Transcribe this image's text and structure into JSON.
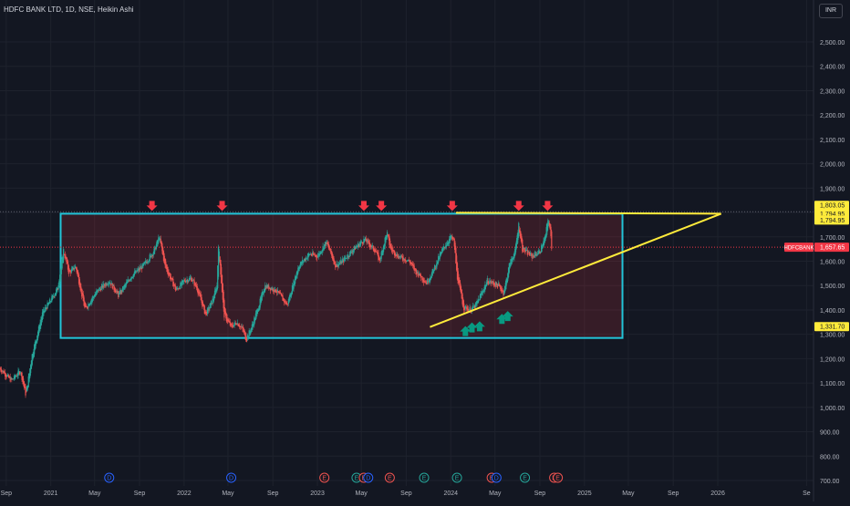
{
  "header": {
    "title": "HDFC BANK LTD, 1D, NSE, Heikin Ashi",
    "currency": "INR"
  },
  "chart_data": {
    "type": "candlestick",
    "symbol": "HDFCBANK",
    "ylim": [
      700,
      2600
    ],
    "y_ticks": [
      700,
      800,
      900,
      1000,
      1100,
      1200,
      1300,
      1400,
      1500,
      1600,
      1700,
      1800,
      1900,
      2000,
      2100,
      2200,
      2300,
      2400,
      2500
    ],
    "y_tick_labels": [
      "700.00",
      "800.00",
      "900.00",
      "1,000.00",
      "1,100.00",
      "1,200.00",
      "1,300.00",
      "1,400.00",
      "1,500.00",
      "1,600.00",
      "1,700.00",
      "1,800.00",
      "1,900.00",
      "2,000.00",
      "2,100.00",
      "2,200.00",
      "2,300.00",
      "2,400.00",
      "2,500.00"
    ],
    "x_labels": [
      "Sep",
      "2021",
      "May",
      "Sep",
      "2022",
      "May",
      "Sep",
      "2023",
      "May",
      "Sep",
      "2024",
      "May",
      "Sep",
      "2025",
      "May",
      "Sep",
      "2026",
      "Se"
    ],
    "x_label_dates": [
      "2020-09-01",
      "2021-01-01",
      "2021-05-01",
      "2021-09-01",
      "2022-01-01",
      "2022-05-01",
      "2022-09-01",
      "2023-01-01",
      "2023-05-01",
      "2023-09-01",
      "2024-01-01",
      "2024-05-01",
      "2024-09-01",
      "2025-01-01",
      "2025-05-01",
      "2025-09-01",
      "2026-01-01",
      "2026-09-01"
    ],
    "x_range": [
      "2020-08-15",
      "2026-09-20"
    ],
    "price_path": [
      [
        "2020-08-15",
        1160
      ],
      [
        "2020-09-15",
        1110
      ],
      [
        "2020-10-10",
        1150
      ],
      [
        "2020-10-25",
        1050
      ],
      [
        "2020-11-10",
        1210
      ],
      [
        "2020-12-10",
        1390
      ],
      [
        "2021-01-01",
        1440
      ],
      [
        "2021-01-20",
        1490
      ],
      [
        "2021-02-05",
        1645
      ],
      [
        "2021-02-20",
        1550
      ],
      [
        "2021-03-10",
        1580
      ],
      [
        "2021-04-05",
        1400
      ],
      [
        "2021-04-20",
        1440
      ],
      [
        "2021-05-10",
        1480
      ],
      [
        "2021-06-10",
        1520
      ],
      [
        "2021-07-05",
        1460
      ],
      [
        "2021-08-10",
        1540
      ],
      [
        "2021-09-10",
        1580
      ],
      [
        "2021-10-10",
        1640
      ],
      [
        "2021-10-25",
        1700
      ],
      [
        "2021-11-10",
        1580
      ],
      [
        "2021-12-10",
        1480
      ],
      [
        "2022-01-01",
        1520
      ],
      [
        "2022-01-20",
        1530
      ],
      [
        "2022-02-05",
        1490
      ],
      [
        "2022-03-01",
        1380
      ],
      [
        "2022-03-20",
        1440
      ],
      [
        "2022-04-01",
        1500
      ],
      [
        "2022-04-05",
        1670
      ],
      [
        "2022-04-20",
        1380
      ],
      [
        "2022-05-10",
        1330
      ],
      [
        "2022-05-25",
        1350
      ],
      [
        "2022-06-10",
        1320
      ],
      [
        "2022-06-20",
        1280
      ],
      [
        "2022-07-05",
        1330
      ],
      [
        "2022-07-25",
        1420
      ],
      [
        "2022-08-10",
        1500
      ],
      [
        "2022-09-10",
        1480
      ],
      [
        "2022-10-10",
        1420
      ],
      [
        "2022-11-10",
        1580
      ],
      [
        "2022-12-10",
        1630
      ],
      [
        "2023-01-01",
        1620
      ],
      [
        "2023-01-25",
        1680
      ],
      [
        "2023-02-20",
        1580
      ],
      [
        "2023-03-10",
        1600
      ],
      [
        "2023-04-10",
        1650
      ],
      [
        "2023-05-10",
        1690
      ],
      [
        "2023-06-10",
        1640
      ],
      [
        "2023-06-20",
        1600
      ],
      [
        "2023-07-10",
        1720
      ],
      [
        "2023-07-20",
        1650
      ],
      [
        "2023-08-10",
        1620
      ],
      [
        "2023-09-10",
        1600
      ],
      [
        "2023-09-25",
        1560
      ],
      [
        "2023-10-10",
        1540
      ],
      [
        "2023-10-26",
        1510
      ],
      [
        "2023-11-10",
        1550
      ],
      [
        "2023-12-10",
        1650
      ],
      [
        "2024-01-01",
        1700
      ],
      [
        "2024-01-10",
        1680
      ],
      [
        "2024-01-18",
        1540
      ],
      [
        "2024-02-05",
        1410
      ],
      [
        "2024-02-25",
        1400
      ],
      [
        "2024-03-10",
        1420
      ],
      [
        "2024-04-10",
        1520
      ],
      [
        "2024-05-10",
        1500
      ],
      [
        "2024-05-25",
        1470
      ],
      [
        "2024-06-10",
        1590
      ],
      [
        "2024-06-25",
        1640
      ],
      [
        "2024-07-05",
        1750
      ],
      [
        "2024-07-15",
        1650
      ],
      [
        "2024-08-10",
        1620
      ],
      [
        "2024-09-01",
        1640
      ],
      [
        "2024-09-16",
        1700
      ],
      [
        "2024-09-24",
        1780
      ],
      [
        "2024-10-01",
        1700
      ],
      [
        "2024-10-03",
        1657.65
      ]
    ],
    "last_price": 1657.65,
    "price_labels": [
      {
        "text": "1,803.05",
        "price": 1803.05,
        "style": "yellow"
      },
      {
        "text": "1,794.95",
        "price": 1794.95,
        "style": "yellow"
      },
      {
        "text": "1,794.95",
        "price": 1794.95,
        "style": "yellow"
      },
      {
        "text": "1,657.65",
        "price": 1657.65,
        "style": "red"
      },
      {
        "text": "1,331.70",
        "price": 1331.7,
        "style": "yellow"
      }
    ],
    "rectangle": {
      "start": "2021-01-28",
      "end": "2025-04-15",
      "top": 1794.95,
      "bottom": 1285
    },
    "resistance_line": {
      "start": "2024-01-15",
      "end": "2026-01-10",
      "price": 1794.95
    },
    "trend_line": {
      "start": "2023-11-05",
      "start_price": 1330,
      "end": "2026-01-10",
      "end_price": 1794.95
    },
    "resistance_arrows": [
      "2021-10-05",
      "2022-04-15",
      "2023-05-08",
      "2023-06-25",
      "2024-01-05",
      "2024-07-05",
      "2024-09-22"
    ],
    "support_arrows": [
      [
        "2024-02-10",
        1300
      ],
      [
        "2024-02-28",
        1315
      ],
      [
        "2024-03-20",
        1320
      ],
      [
        "2024-05-20",
        1350
      ],
      [
        "2024-06-05",
        1362
      ]
    ],
    "events": [
      {
        "date": "2021-06-10",
        "label": "D",
        "kind": "dividend"
      },
      {
        "date": "2022-05-10",
        "label": "D",
        "kind": "dividend"
      },
      {
        "date": "2023-01-20",
        "label": "E",
        "kind": "earnings-red"
      },
      {
        "date": "2023-04-18",
        "label": "E",
        "kind": "earnings-green"
      },
      {
        "date": "2023-05-08",
        "label": "E",
        "kind": "earnings-red"
      },
      {
        "date": "2023-05-20",
        "label": "D",
        "kind": "dividend"
      },
      {
        "date": "2023-07-18",
        "label": "E",
        "kind": "earnings-red"
      },
      {
        "date": "2023-10-20",
        "label": "E",
        "kind": "earnings-green"
      },
      {
        "date": "2024-01-18",
        "label": "E",
        "kind": "earnings-green"
      },
      {
        "date": "2024-04-22",
        "label": "E",
        "kind": "earnings-red"
      },
      {
        "date": "2024-05-05",
        "label": "D",
        "kind": "dividend"
      },
      {
        "date": "2024-07-22",
        "label": "E",
        "kind": "earnings-green"
      },
      {
        "date": "2024-10-10",
        "label": "E",
        "kind": "earnings-red"
      },
      {
        "date": "2024-10-20",
        "label": "E",
        "kind": "earnings-red"
      }
    ],
    "colors": {
      "background": "#131722",
      "up": "#26a69a",
      "down": "#ef5350",
      "rect_border": "#22c4d8",
      "yellow": "#ffeb3b",
      "grid": "#1e222d",
      "axis_text": "#b2b5be",
      "red_arrow": "#f23645",
      "green_arrow": "#089981",
      "dividend": "#2962ff"
    }
  }
}
